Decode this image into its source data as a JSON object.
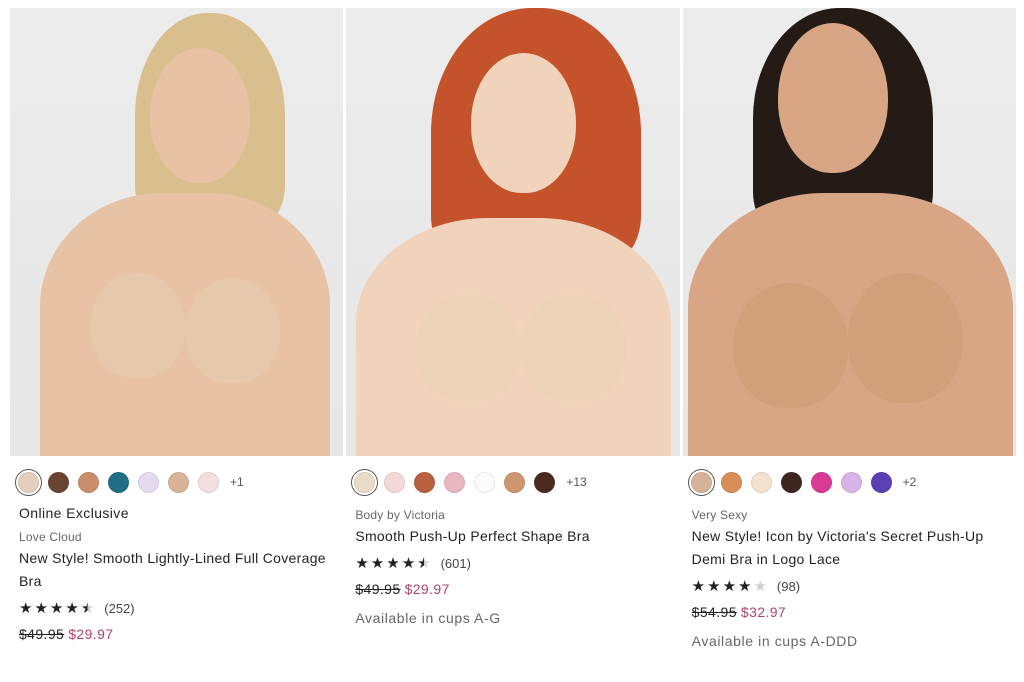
{
  "products": [
    {
      "flag": "Online Exclusive",
      "brand": "Love Cloud",
      "name": "New Style! Smooth Lightly-Lined Full Coverage Bra",
      "rating": 4.5,
      "review_count": "(252)",
      "original_price": "$49.95",
      "sale_price": "$29.97",
      "cups": "",
      "more_colors": "+1",
      "swatches": [
        "#e3cfbb",
        "#6b4431",
        "#c98e6b",
        "#1f6e86",
        "#e4dbf0",
        "#d9b398",
        "#f3dee0"
      ],
      "skin": "#e7c2a5",
      "hair": "#d9bf8e",
      "bra": "#e6c9ad"
    },
    {
      "flag": "",
      "brand": "Body by Victoria",
      "name": "Smooth Push-Up Perfect Shape Bra",
      "rating": 4.5,
      "review_count": "(601)",
      "original_price": "$49.95",
      "sale_price": "$29.97",
      "cups": "Available in cups A-G",
      "more_colors": "+13",
      "swatches": [
        "#e9dcc6",
        "#f2d9d5",
        "#b8603f",
        "#eab7c0",
        "#fbfbfb",
        "#cf9570",
        "#4d2a20"
      ],
      "skin": "#f1d3bc",
      "hair": "#c4532b",
      "bra": "#ecd2b6"
    },
    {
      "flag": "",
      "brand": "Very Sexy",
      "name": "New Style! Icon by Victoria's Secret Push-Up Demi Bra in Logo Lace",
      "rating": 4,
      "review_count": "(98)",
      "original_price": "$54.95",
      "sale_price": "$32.97",
      "cups": "Available in cups A-DDD",
      "more_colors": "+2",
      "swatches": [
        "#d7b198",
        "#d98e56",
        "#f2e2cf",
        "#3e2620",
        "#d93a94",
        "#d8b3e6",
        "#5b3fb5"
      ],
      "skin": "#d8a585",
      "hair": "#241b17",
      "bra": "#d1a07a"
    }
  ]
}
